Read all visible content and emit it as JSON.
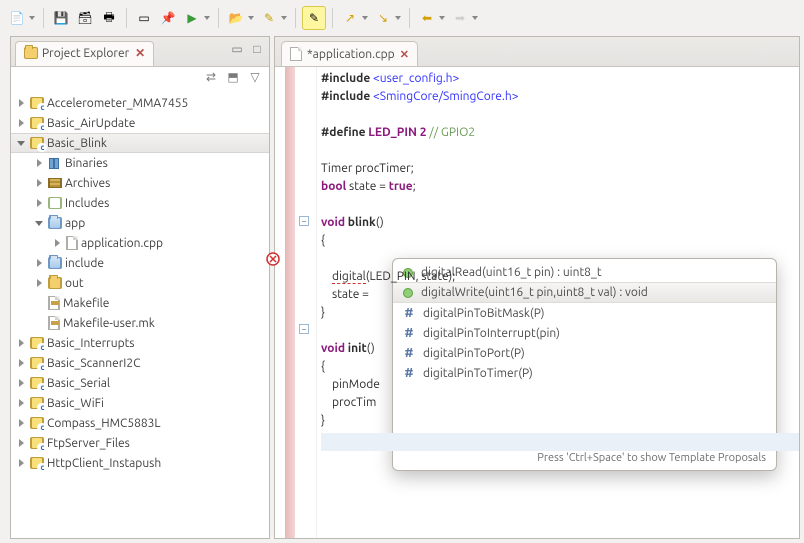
{
  "explorer": {
    "title": "Project Explorer",
    "items": [
      {
        "label": "Accelerometer_MMA7455",
        "depth": 0,
        "kind": "prj",
        "tw": "closed"
      },
      {
        "label": "Basic_AirUpdate",
        "depth": 0,
        "kind": "prj",
        "tw": "closed"
      },
      {
        "label": "Basic_Blink",
        "depth": 0,
        "kind": "prj",
        "tw": "open",
        "sel": true
      },
      {
        "label": "Binaries",
        "depth": 1,
        "kind": "bin",
        "tw": "closed"
      },
      {
        "label": "Archives",
        "depth": 1,
        "kind": "arc",
        "tw": "closed"
      },
      {
        "label": "Includes",
        "depth": 1,
        "kind": "inc",
        "tw": "closed"
      },
      {
        "label": "app",
        "depth": 1,
        "kind": "foldblue",
        "tw": "open"
      },
      {
        "label": "application.cpp",
        "depth": 2,
        "kind": "file",
        "tw": "closed"
      },
      {
        "label": "include",
        "depth": 1,
        "kind": "foldblue",
        "tw": "closed"
      },
      {
        "label": "out",
        "depth": 1,
        "kind": "fold",
        "tw": "closed"
      },
      {
        "label": "Makefile",
        "depth": 1,
        "kind": "mk",
        "tw": "none"
      },
      {
        "label": "Makefile-user.mk",
        "depth": 1,
        "kind": "mk",
        "tw": "none"
      },
      {
        "label": "Basic_Interrupts",
        "depth": 0,
        "kind": "prj",
        "tw": "closed"
      },
      {
        "label": "Basic_ScannerI2C",
        "depth": 0,
        "kind": "prj",
        "tw": "closed"
      },
      {
        "label": "Basic_Serial",
        "depth": 0,
        "kind": "prj",
        "tw": "closed"
      },
      {
        "label": "Basic_WiFi",
        "depth": 0,
        "kind": "prj",
        "tw": "closed"
      },
      {
        "label": "Compass_HMC5883L",
        "depth": 0,
        "kind": "prj",
        "tw": "closed"
      },
      {
        "label": "FtpServer_Files",
        "depth": 0,
        "kind": "prj",
        "tw": "closed"
      },
      {
        "label": "HttpClient_Instapush",
        "depth": 0,
        "kind": "prj",
        "tw": "closed"
      }
    ]
  },
  "editor": {
    "tabs": [
      {
        "label": "*application.cpp"
      }
    ],
    "code_lines": [
      {
        "html": "<span class='inc'>#include</span> <span class='str'>&lt;user_config.h&gt;</span>"
      },
      {
        "html": "<span class='inc'>#include</span> <span class='str'>&lt;SmingCore/SmingCore.h&gt;</span>"
      },
      {
        "html": ""
      },
      {
        "html": "<span class='inc'>#define</span> <span class='kw'>LED_PIN 2</span> <span class='cm'>// GPIO2</span>"
      },
      {
        "html": ""
      },
      {
        "html": "Timer procTimer;"
      },
      {
        "html": "<span class='kw'>bool</span> state = <span class='kw'>true</span>;"
      },
      {
        "html": ""
      },
      {
        "html": "<span class='kw'>void</span> <b>blink</b>()",
        "fold": true
      },
      {
        "html": "{"
      },
      {
        "html": "    <span class='err-underline'>digital</span>(LED_PIN, state);",
        "current": true,
        "error": true
      },
      {
        "html": "    state = "
      },
      {
        "html": "}"
      },
      {
        "html": ""
      },
      {
        "html": "<span class='kw'>void</span> <b>init</b>()",
        "fold": true
      },
      {
        "html": "{"
      },
      {
        "html": "    pinMode"
      },
      {
        "html": "    procTim"
      },
      {
        "html": "}"
      }
    ]
  },
  "completion": {
    "items": [
      {
        "kind": "func",
        "label": "digitalRead(uint16_t pin) : uint8_t"
      },
      {
        "kind": "func",
        "label": "digitalWrite(uint16_t pin,uint8_t val) : void",
        "sel": true
      },
      {
        "kind": "macro",
        "label": "digitalPinToBitMask(P)"
      },
      {
        "kind": "macro",
        "label": "digitalPinToInterrupt(pin)"
      },
      {
        "kind": "macro",
        "label": "digitalPinToPort(P)"
      },
      {
        "kind": "macro",
        "label": "digitalPinToTimer(P)"
      }
    ],
    "footer": "Press 'Ctrl+Space' to show Template Proposals"
  },
  "toolbar_icons": [
    "new",
    "save",
    "save-all",
    "print",
    "build",
    "pin",
    "run",
    "debug",
    "",
    "open",
    "highlight",
    "",
    "marker",
    "back-bookmark",
    "fwd-bookmark",
    "",
    "prev",
    "next"
  ]
}
